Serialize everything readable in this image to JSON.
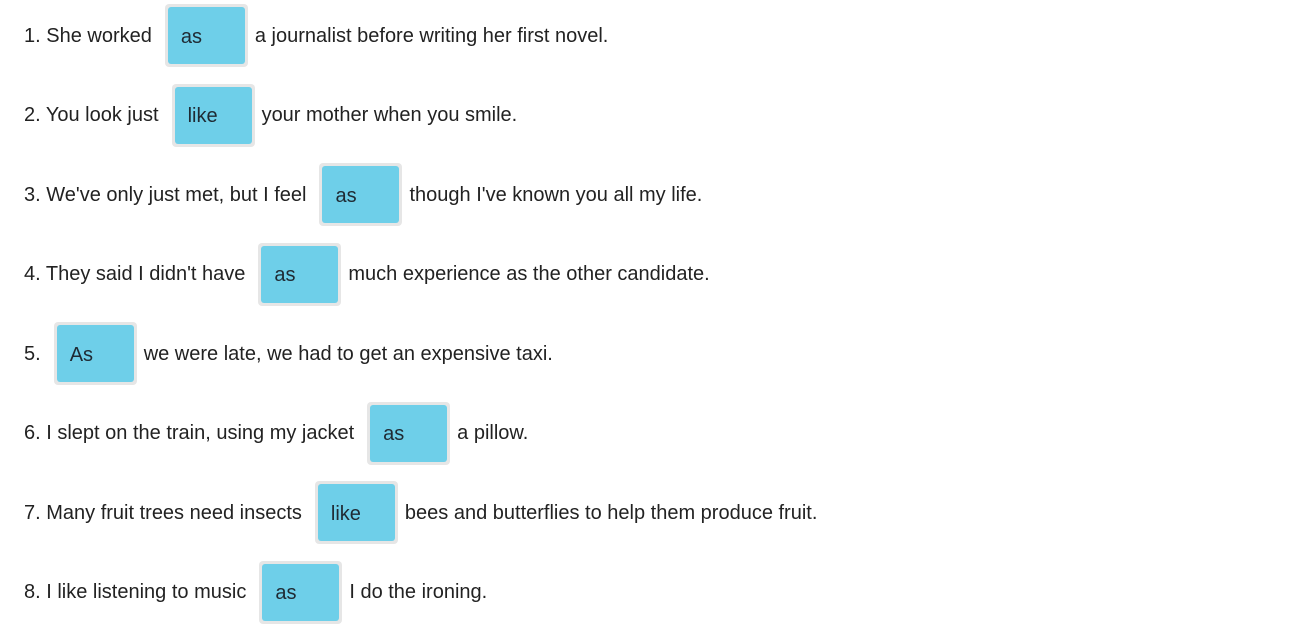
{
  "colors": {
    "chip_background": "#6ecfe9",
    "slot_border": "#e6e6e6",
    "text": "#222222"
  },
  "sentences": [
    {
      "before": "1. She worked",
      "answer": "as",
      "after": "a journalist before writing her first novel."
    },
    {
      "before": "2. You look just",
      "answer": "like",
      "after": "your mother when you smile."
    },
    {
      "before": "3. We've only just met, but I feel",
      "answer": "as",
      "after": "though I've known you all my life."
    },
    {
      "before": "4. They said I didn't have",
      "answer": "as",
      "after": "much experience as the other candidate."
    },
    {
      "before": "5.",
      "answer": "As",
      "after": "we were late, we had to get an expensive taxi."
    },
    {
      "before": "6. I slept on the train, using my jacket",
      "answer": "as",
      "after": "a pillow."
    },
    {
      "before": "7. Many fruit trees need insects",
      "answer": "like",
      "after": "bees and butterflies to help them produce fruit."
    },
    {
      "before": "8. I like listening to music",
      "answer": "as",
      "after": "I do the ironing."
    }
  ]
}
